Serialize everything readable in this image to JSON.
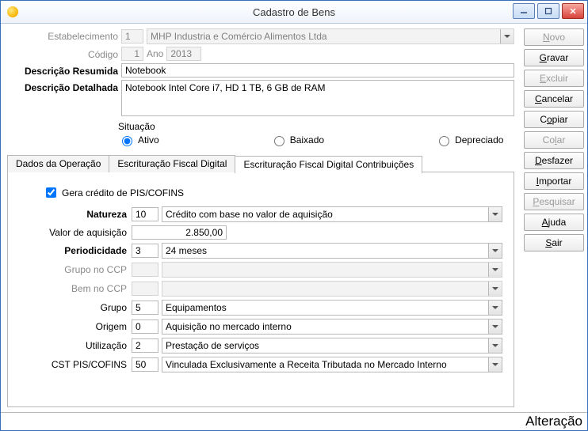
{
  "window": {
    "title": "Cadastro de Bens"
  },
  "sidebar": {
    "novo": "Novo",
    "gravar": "Gravar",
    "excluir": "Excluir",
    "cancelar": "Cancelar",
    "copiar": "Copiar",
    "colar": "Colar",
    "desfazer": "Desfazer",
    "importar": "Importar",
    "pesquisar": "Pesquisar",
    "ajuda": "Ajuda",
    "sair": "Sair"
  },
  "header": {
    "estabelecimento_label": "Estabelecimento",
    "estabelecimento_val": "1",
    "estabelecimento_name": "MHP Industria e Comércio Alimentos Ltda",
    "codigo_label": "Código",
    "codigo_val": "1",
    "ano_label": "Ano",
    "ano_val": "2013",
    "desc_resumida_label": "Descrição Resumida",
    "desc_resumida_val": "Notebook",
    "desc_detalhada_label": "Descrição Detalhada",
    "desc_detalhada_val": "Notebook Intel Core i7, HD 1 TB, 6 GB de RAM"
  },
  "situacao": {
    "legend": "Situação",
    "ativo": "Ativo",
    "baixado": "Baixado",
    "depreciado": "Depreciado",
    "selected": "ativo"
  },
  "tabs": {
    "t0": "Dados da Operação",
    "t1": "Escrituração Fiscal Digital",
    "t2": "Escrituração Fiscal Digital Contribuições"
  },
  "efdc": {
    "gera_label": "Gera crédito de PIS/COFINS",
    "gera_checked": true,
    "natureza_label": "Natureza",
    "natureza_code": "10",
    "natureza_text": "Crédito com base no valor de aquisição",
    "valor_label": "Valor de aquisição",
    "valor": "2.850,00",
    "periodicidade_label": "Periodicidade",
    "periodicidade_code": "3",
    "periodicidade_text": "24 meses",
    "grupo_ccp_label": "Grupo no CCP",
    "grupo_ccp_code": "",
    "grupo_ccp_text": "",
    "bem_ccp_label": "Bem no CCP",
    "bem_ccp_code": "",
    "bem_ccp_text": "",
    "grupo_label": "Grupo",
    "grupo_code": "5",
    "grupo_text": "Equipamentos",
    "origem_label": "Origem",
    "origem_code": "0",
    "origem_text": "Aquisição no mercado interno",
    "utilizacao_label": "Utilização",
    "utilizacao_code": "2",
    "utilizacao_text": "Prestação de serviços",
    "cst_label": "CST PIS/COFINS",
    "cst_code": "50",
    "cst_text": "Vinculada Exclusivamente a Receita Tributada no Mercado Interno"
  },
  "status": {
    "mode": "Alteração"
  }
}
